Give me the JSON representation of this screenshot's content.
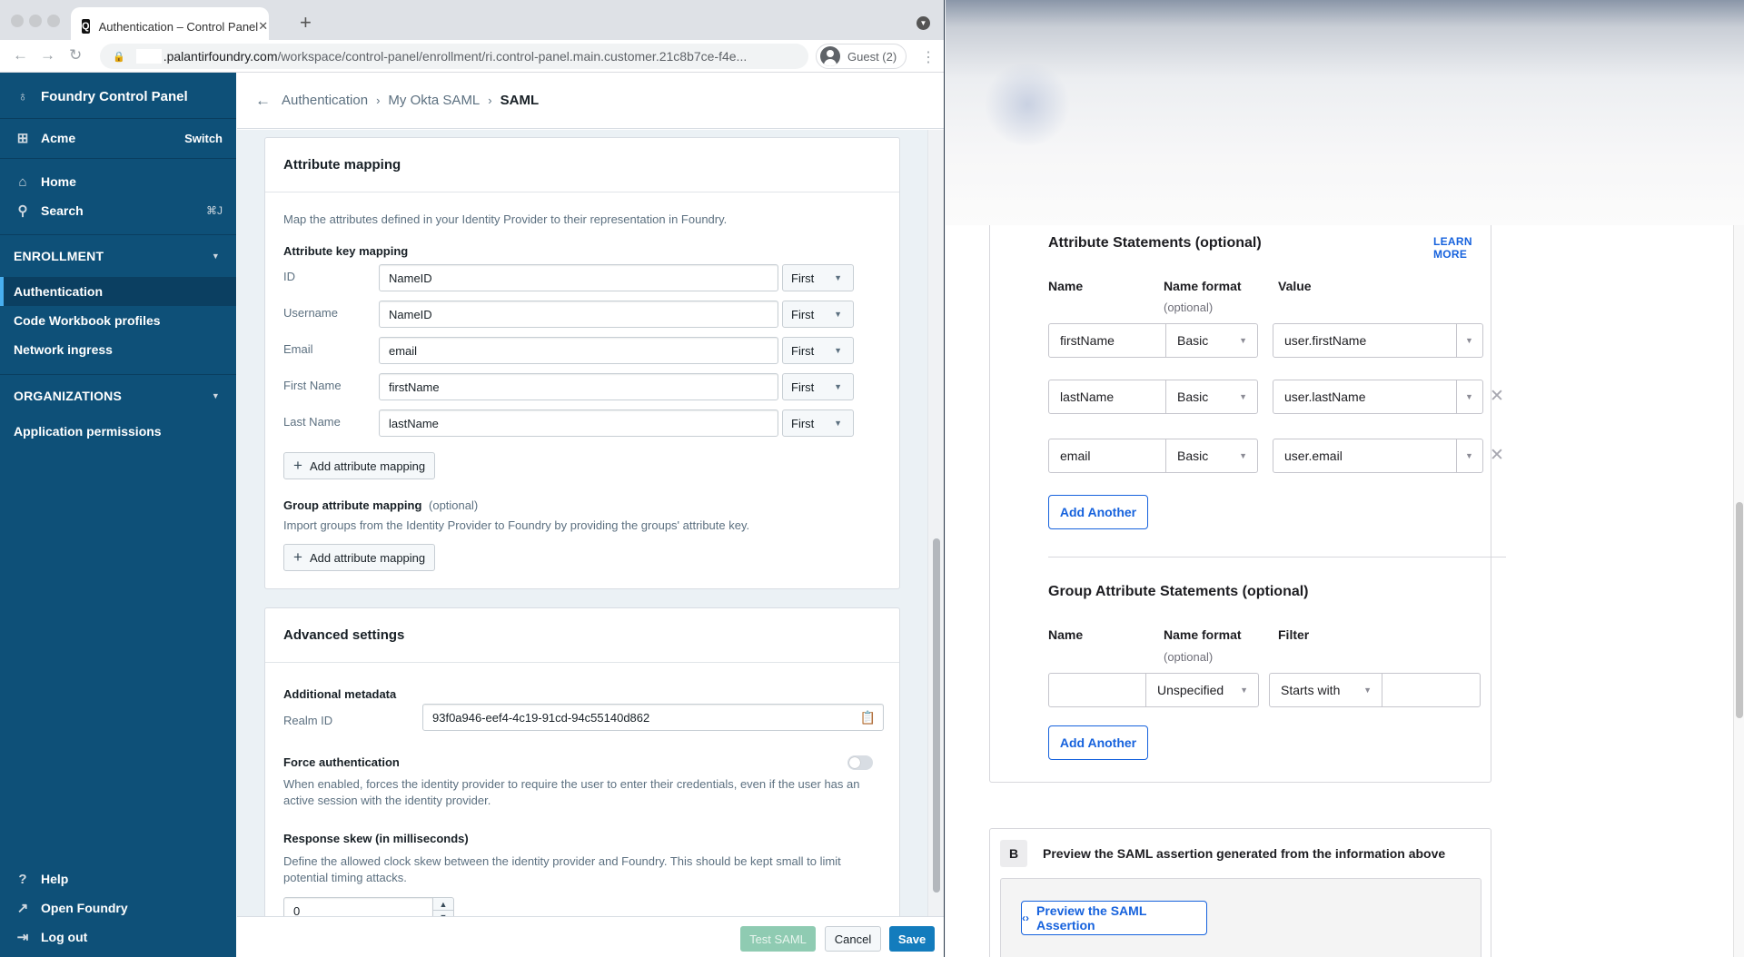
{
  "browser": {
    "tab_title": "Authentication – Control Panel",
    "tab_close": "✕",
    "new_tab": "+",
    "url_host": ".palantirfoundry.com",
    "url_path": "/workspace/control-panel/enrollment/ri.control-panel.main.customer.21c8b7ce-f4e...",
    "profile_label": "Guest (2)"
  },
  "sidebar": {
    "app_title": "Foundry Control Panel",
    "org_name": "Acme",
    "org_switch": "Switch",
    "home": "Home",
    "search": "Search",
    "search_shortcut": "⌘J",
    "sections": [
      {
        "title": "ENROLLMENT",
        "items": [
          "Authentication",
          "Code Workbook profiles",
          "Network ingress"
        ],
        "active_index": 0
      },
      {
        "title": "ORGANIZATIONS",
        "items": [
          "Application permissions"
        ]
      }
    ],
    "footer": {
      "help": "Help",
      "open_foundry": "Open Foundry",
      "log_out": "Log out"
    }
  },
  "breadcrumb": {
    "items": [
      "Authentication",
      "My Okta SAML"
    ],
    "current": "SAML"
  },
  "attribute_mapping": {
    "title": "Attribute mapping",
    "description": "Map the attributes defined in your Identity Provider to their representation in Foundry.",
    "key_mapping_label": "Attribute key mapping",
    "rows": [
      {
        "label": "ID",
        "value": "NameID",
        "mode": "First"
      },
      {
        "label": "Username",
        "value": "NameID",
        "mode": "First"
      },
      {
        "label": "Email",
        "value": "email",
        "mode": "First"
      },
      {
        "label": "First Name",
        "value": "firstName",
        "mode": "First"
      },
      {
        "label": "Last Name",
        "value": "lastName",
        "mode": "First"
      }
    ],
    "add_button": "Add attribute mapping",
    "group_label": "Group attribute mapping",
    "group_optional": "(optional)",
    "group_description": "Import groups from the Identity Provider to Foundry by providing the groups' attribute key.",
    "group_add_button": "Add attribute mapping"
  },
  "advanced": {
    "title": "Advanced settings",
    "metadata_label": "Additional metadata",
    "realm_label": "Realm ID",
    "realm_value": "93f0a946-eef4-4c19-91cd-94c55140d862",
    "force_auth_label": "Force authentication",
    "force_auth_enabled": false,
    "force_auth_description": "When enabled, forces the identity provider to require the user to enter their credentials, even if the user has an active session with the identity provider.",
    "skew_label": "Response skew (in milliseconds)",
    "skew_description": "Define the allowed clock skew between the identity provider and Foundry. This should be kept small to limit potential timing attacks.",
    "skew_value": "0"
  },
  "footer_actions": {
    "test": "Test SAML",
    "cancel": "Cancel",
    "save": "Save"
  },
  "okta": {
    "attr_title": "Attribute Statements (optional)",
    "learn_more": "LEARN MORE",
    "col_name": "Name",
    "col_format": "Name format",
    "col_optional": "(optional)",
    "col_value": "Value",
    "statements": [
      {
        "name": "firstName",
        "format": "Basic",
        "value": "user.firstName",
        "removable": false
      },
      {
        "name": "lastName",
        "format": "Basic",
        "value": "user.lastName",
        "removable": true
      },
      {
        "name": "email",
        "format": "Basic",
        "value": "user.email",
        "removable": true
      }
    ],
    "add_another": "Add Another",
    "group_title": "Group Attribute Statements (optional)",
    "group_col_name": "Name",
    "group_col_format": "Name format",
    "group_col_optional": "(optional)",
    "group_col_filter": "Filter",
    "group_row": {
      "name": "",
      "format": "Unspecified",
      "filter_type": "Starts with",
      "filter_value": ""
    },
    "group_add_another": "Add Another",
    "preview_step": "B",
    "preview_title": "Preview the SAML assertion generated from the information above",
    "preview_button": "Preview the SAML Assertion"
  },
  "colors": {
    "sidebar_bg": "#0e5078",
    "sidebar_active": "#0b3f61",
    "active_indicator": "#48aff0",
    "primary": "#137cbd",
    "success_disabled": "#8fcbb2",
    "okta_blue": "#1662dd"
  }
}
